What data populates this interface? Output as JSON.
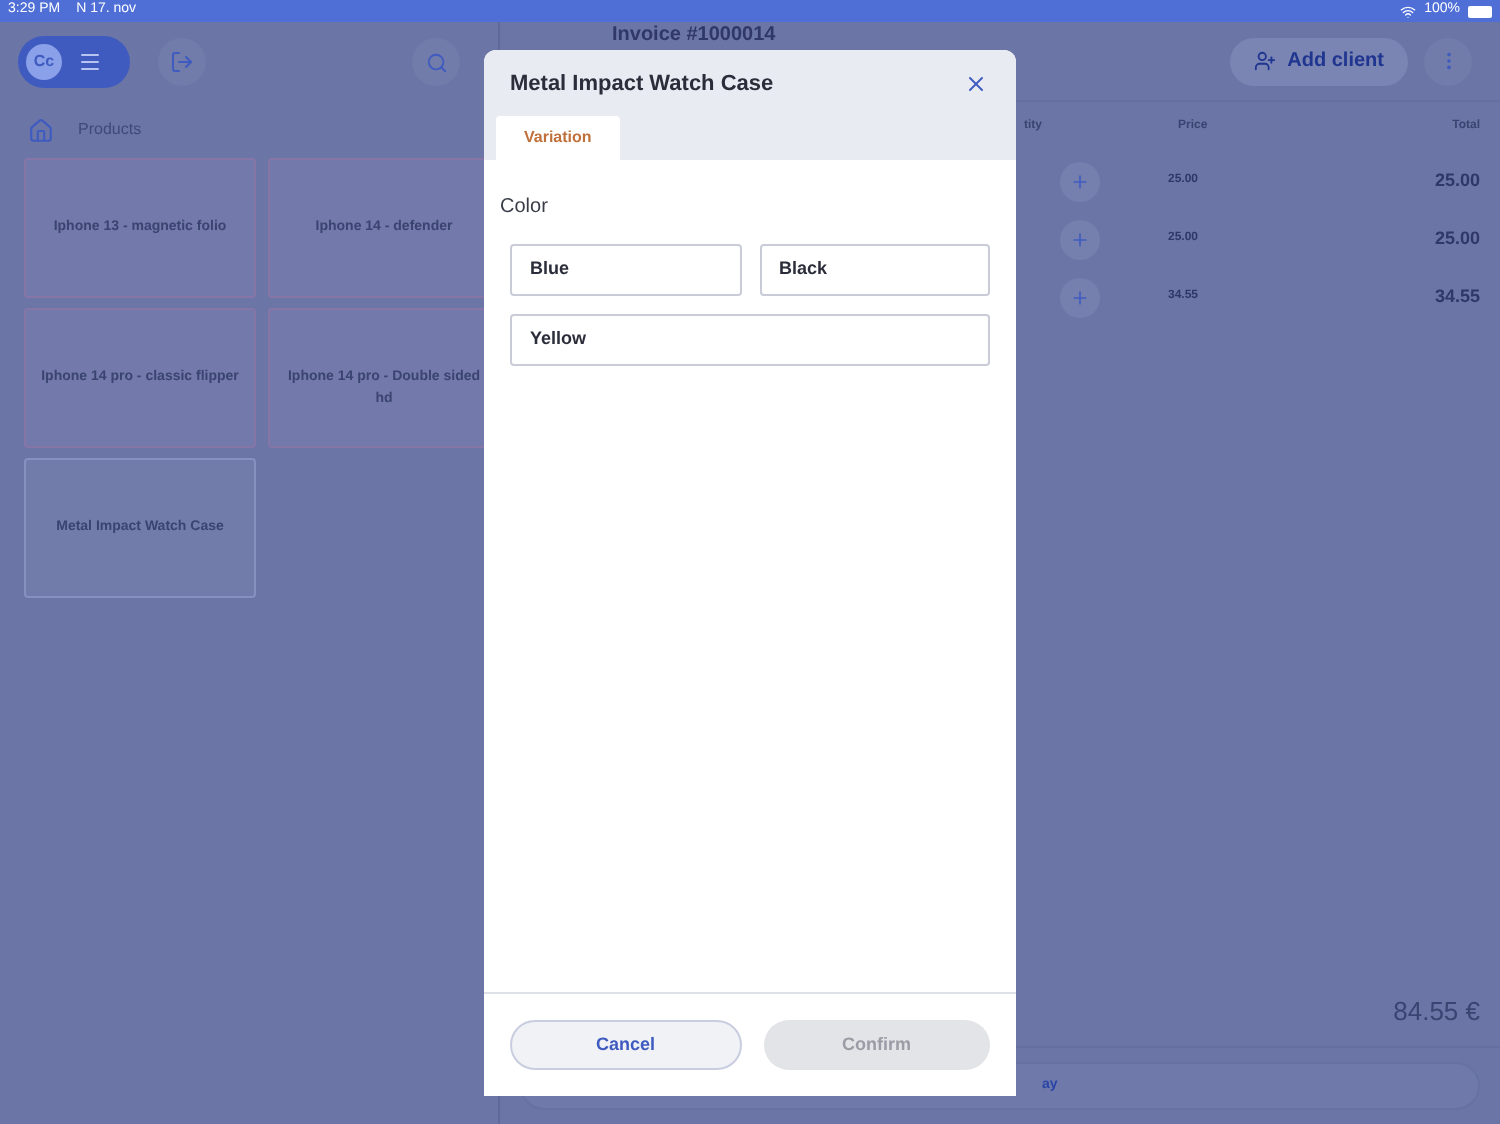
{
  "status_bar": {
    "time": "3:29 PM",
    "date": "N 17. nov",
    "battery": "100%"
  },
  "sidebar": {
    "logo": "Cc",
    "breadcrumb": "Products",
    "products": [
      {
        "name": "Iphone 13 - magnetic folio",
        "highlighted": true
      },
      {
        "name": "Iphone 14 - defender",
        "highlighted": true
      },
      {
        "name": "Iphone 14  pro - classic flipper",
        "highlighted": true
      },
      {
        "name": "Iphone 14 pro - Double sided hd",
        "highlighted": true
      },
      {
        "name": "Metal Impact Watch Case",
        "highlighted": false
      }
    ]
  },
  "invoice": {
    "title": "Invoice #1000014",
    "add_client": "Add client",
    "columns": [
      "tity",
      "Price",
      "Total"
    ],
    "rows": [
      {
        "price": "25.00",
        "total": "25.00"
      },
      {
        "price": "25.00",
        "total": "25.00"
      },
      {
        "price": "34.55",
        "total": "34.55"
      }
    ],
    "sum": "84.55 €",
    "pay": "ay"
  },
  "dialog": {
    "title": "Metal Impact Watch Case",
    "tabs": [
      {
        "label": "Variation",
        "selected": true
      }
    ],
    "group": "Color",
    "options": [
      {
        "label": "Blue",
        "selected": false
      },
      {
        "label": "Black",
        "selected": false
      },
      {
        "label": "Yellow",
        "selected": false
      }
    ],
    "cancel": "Cancel",
    "confirm": {
      "label": "Confirm",
      "disabled": true
    }
  }
}
